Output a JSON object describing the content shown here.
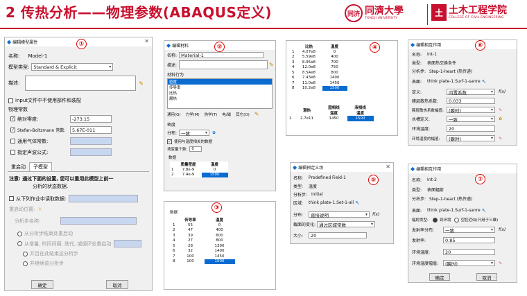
{
  "header": {
    "title": "2 传热分析——物理参数(ABAQUS定义)",
    "logo1_text": "同濟大學",
    "logo1_sub": "TONGJI UNIVERSITY",
    "logo1_seal": "同济",
    "logo2_text": "土木工程学院",
    "logo2_sub": "COLLEGE OF CIVIL ENGINEERING",
    "logo2_mark": "土"
  },
  "w1": {
    "title": "编辑模型属性",
    "badge": "①",
    "name_label": "名称:",
    "name": "Model-1",
    "type_label": "模型类型:",
    "type": "Standard & Explicit",
    "desc_label": "描述:",
    "input_cb": "input文件中不使用部件和装配",
    "section": "物理常数",
    "abs_zero_label": "绝对零度:",
    "abs_zero": "-273.15",
    "sb_label": "Stefan-Boltzmann 常数:",
    "sb": "5.67E-011",
    "gas_label": "通用气体常数:",
    "sound_label": "指定声波公式:",
    "tab1": "重启动",
    "tab2": "子模型",
    "note1": "注意: 通过下面的设置, 您可以重用此模型上前一",
    "note2": "分析的状态数据.",
    "read_cb": "从下列作业中读取数据:",
    "restart_loc": "重启动位置:",
    "step_label": "分析步名称:",
    "r1": "从分析步结束处重启动",
    "r2": "从增量, 时间间隔, 迭代, 或循环处重启动",
    "r3": "并且在此结束这分析步",
    "r4": "并继续该分析步",
    "ok": "确定",
    "cancel": "取消"
  },
  "w2": {
    "title": "编辑材料",
    "badge": "②",
    "name_label": "名称:",
    "name": "Material-1",
    "desc_label": "描述:",
    "behav": "材料行为",
    "items": [
      "密度",
      "传导率",
      "比热",
      "屠热"
    ],
    "menu": [
      "通用(G)",
      "力学(M)",
      "热学(T)",
      "电/磁",
      "其它(O)"
    ],
    "sub": "密度",
    "dist_label": "分布:",
    "dist": "一致",
    "cb": "使用与温度相关的数据",
    "field_label": "场变量个数:",
    "field": "0",
    "data": "数据",
    "cols": [
      "质量密度",
      "温度"
    ],
    "rows": [
      [
        "1",
        "7.8e-9",
        "0"
      ],
      [
        "2",
        "7.4e-9",
        "1500"
      ]
    ]
  },
  "w3": {
    "badge": "③",
    "data": "数据",
    "cols": [
      "传导率",
      "温度"
    ],
    "rows": [
      [
        "1",
        "55",
        "0"
      ],
      [
        "2",
        "47",
        "400"
      ],
      [
        "3",
        "39",
        "600"
      ],
      [
        "4",
        "27",
        "800"
      ],
      [
        "5",
        "28",
        "1300"
      ],
      [
        "6",
        "32",
        "1400"
      ],
      [
        "7",
        "100",
        "1450"
      ],
      [
        "8",
        "100",
        "1500"
      ]
    ]
  },
  "w4": {
    "badge": "④",
    "cols": [
      "比热",
      "温度"
    ],
    "rows": [
      [
        "1",
        "4.07e8",
        "0"
      ],
      [
        "2",
        "5.59e8",
        "400"
      ],
      [
        "3",
        "8.95e8",
        "700"
      ],
      [
        "4",
        "12.0e8",
        "750"
      ],
      [
        "5",
        "8.54e8",
        "800"
      ],
      [
        "6",
        "7.43e8",
        "1400"
      ],
      [
        "7",
        "11.0e8",
        "1450"
      ],
      [
        "8",
        "10.2e8",
        "1500"
      ]
    ],
    "cols2": [
      "潜热",
      "固相线\n温度",
      "液相线\n温度"
    ],
    "row2": [
      "1",
      "2.7e11",
      "1450",
      "1500"
    ]
  },
  "w5": {
    "title": "编辑预定义场",
    "badge": "⑤",
    "name_label": "名称:",
    "name": "Predefined Field-1",
    "type_label": "类型:",
    "type": "温度",
    "step_label": "分析步:",
    "step": "Initial",
    "region_label": "区域:",
    "region": "think plate-1.Set-1-all",
    "dist_label": "分布:",
    "dist": "直接说明",
    "section_label": "截面的变化:",
    "section": "通过区域常数",
    "mag_label": "大小:",
    "mag": "20"
  },
  "w6": {
    "title": "编辑相互作用",
    "badge": "⑥",
    "name_label": "名称:",
    "name": "Int-1",
    "type_label": "类型:",
    "type": "表面热交换条件",
    "step_label": "分析步:",
    "step": "Step-1-heart (热传递)",
    "surf_label": "表面:",
    "surf": "think plate-1.Surf-1-sanre",
    "def_label": "定义:",
    "def": "内置系数",
    "film_label": "膜层散热系数:",
    "film": "0.033",
    "amp1_label": "膜层散热系数幅值:",
    "amp1": "(瞬时)",
    "sink_def_label": "水槽定义:",
    "sink_def": "一致",
    "env_label": "环境温度:",
    "env": "20",
    "amp2_label": "环境温度的幅值:",
    "amp2": "(瞬时)"
  },
  "w7": {
    "title": "编辑相互作用",
    "badge": "⑦",
    "name_label": "名称:",
    "name": "Int-2",
    "type_label": "类型:",
    "type": "表面辐射",
    "step_label": "分析步:",
    "step": "Step-1-heart (热传递)",
    "surf_label": "表面:",
    "surf": "think plate-1.Surf-1-sanre",
    "rad_label": "辐射类型:",
    "rad1": "到环境",
    "rad2": "空腔近似(只用于三维)",
    "emis_dist_label": "发射率分布:",
    "emis_dist": "一致",
    "emis_label": "发射率:",
    "emis": "0.85",
    "env_label": "环境温度:",
    "env": "20",
    "amp_label": "环境温度幅值:",
    "amp": "(瞬时)",
    "ok": "确定",
    "cancel": "取消"
  }
}
